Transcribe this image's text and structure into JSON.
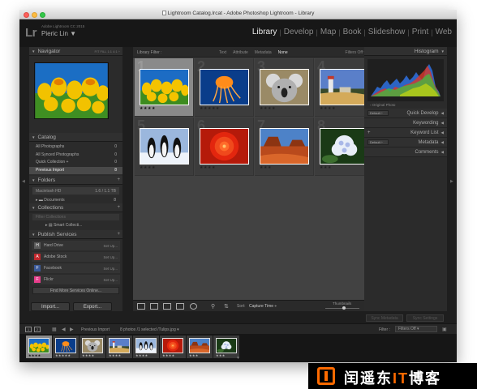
{
  "window": {
    "title": "Lightroom Catalog.lrcat - Adobe Photoshop Lightroom - Library"
  },
  "identity": {
    "logo": "Lr",
    "version": "Adobe Lightroom CC 2015",
    "user": "Pieric Lin ▼"
  },
  "modules": [
    "Library",
    "Develop",
    "Map",
    "Book",
    "Slideshow",
    "Print",
    "Web"
  ],
  "active_module": "Library",
  "navigator": {
    "title": "Navigator",
    "options": "FIT  FILL  1:1  4:1 ÷"
  },
  "catalog": {
    "title": "Catalog",
    "items": [
      {
        "label": "All Photographs",
        "count": "0"
      },
      {
        "label": "All Synced Photographs",
        "count": "0"
      },
      {
        "label": "Quick Collection +",
        "count": "0"
      },
      {
        "label": "Previous Import",
        "count": "8"
      }
    ]
  },
  "folders": {
    "title": "Folders",
    "volume": "Macintosh HD",
    "volume_info": "1.6 / 1.1 TB",
    "folder": "Documents",
    "folder_count": "8"
  },
  "collections": {
    "title": "Collections",
    "search_placeholder": "Filter Collections",
    "item": "Smart Collecti..."
  },
  "publish": {
    "title": "Publish Services",
    "services": [
      {
        "name": "Hard Drive",
        "setup": "Set Up...",
        "icon": "harddrive-icon",
        "color": "#5a5a5a"
      },
      {
        "name": "Adobe Stock",
        "setup": "Set Up...",
        "icon": "adobe-stock-icon",
        "color": "#c0282d"
      },
      {
        "name": "Facebook",
        "setup": "Set Up...",
        "icon": "facebook-icon",
        "color": "#3b5998"
      },
      {
        "name": "Flickr",
        "setup": "Set Up...",
        "icon": "flickr-icon",
        "color": "#e83e8c"
      }
    ],
    "find_more": "Find More Services Online..."
  },
  "buttons": {
    "import": "Import...",
    "export": "Export...",
    "sync_metadata": "Sync Metadata",
    "sync_settings": "Sync Settings"
  },
  "library_filter": {
    "label": "Library Filter :",
    "options": [
      "Text",
      "Attribute",
      "Metadata",
      "None"
    ],
    "active": "None",
    "filters_off": "Filters Off ▾"
  },
  "grid": [
    {
      "index": "1",
      "stars": "★★★★",
      "subject": "tulips",
      "selected": true
    },
    {
      "index": "2",
      "stars": "★★★★★",
      "subject": "jellyfish",
      "selected": false
    },
    {
      "index": "3",
      "stars": "★★★★",
      "subject": "koala",
      "selected": false
    },
    {
      "index": "4",
      "stars": "★★★★",
      "subject": "lighthouse",
      "selected": false
    },
    {
      "index": "5",
      "stars": "★★★★",
      "subject": "penguins",
      "selected": false
    },
    {
      "index": "6",
      "stars": "★★★★",
      "subject": "chrysanthemum",
      "selected": false
    },
    {
      "index": "7",
      "stars": "★★★",
      "subject": "desert",
      "selected": false
    },
    {
      "index": "8",
      "stars": "★★★",
      "subject": "hydrangeas",
      "selected": false
    }
  ],
  "toolbar": {
    "sort_label": "Sort:",
    "sort_value": "Capture Time ÷",
    "thumbnails_label": "Thumbnails"
  },
  "histogram": {
    "title": "Histogram",
    "original_photo": "Original Photo"
  },
  "right_sections": [
    {
      "preset": "Default ÷",
      "name": "Quick Develop"
    },
    {
      "preset": "",
      "name": "Keywording"
    },
    {
      "preset": "+",
      "name": "Keyword List"
    },
    {
      "preset": "Default ÷",
      "name": "Metadata"
    },
    {
      "preset": "",
      "name": "Comments"
    }
  ],
  "filmstrip_bar": {
    "breadcrumb": "Previous Import",
    "info": "8 photos /1 selected /Tulips.jpg ▾",
    "filter_label": "Filter :",
    "filter_value": "Filters Off ▾",
    "page1": "1",
    "page2": "2"
  },
  "filmstrip": [
    {
      "stars": "★★★★",
      "subject": "tulips",
      "selected": true
    },
    {
      "stars": "★★★★★",
      "subject": "jellyfish",
      "selected": false
    },
    {
      "stars": "★★★★",
      "subject": "koala",
      "selected": false
    },
    {
      "stars": "★★★★",
      "subject": "lighthouse",
      "selected": false
    },
    {
      "stars": "★★★★",
      "subject": "penguins",
      "selected": false
    },
    {
      "stars": "★★★★",
      "subject": "chrysanthemum",
      "selected": false
    },
    {
      "stars": "★★★",
      "subject": "desert",
      "selected": false
    },
    {
      "stars": "★★★",
      "subject": "hydrangeas",
      "selected": false
    }
  ],
  "watermark": {
    "text_a": "闰遥东",
    "text_accent": "IT",
    "text_b": "博客"
  }
}
